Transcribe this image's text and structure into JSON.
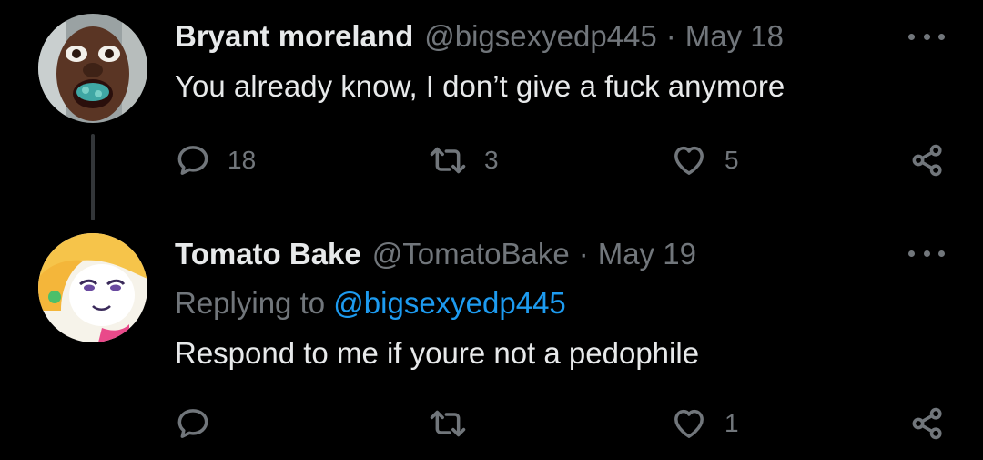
{
  "tweets": [
    {
      "display_name": "Bryant moreland",
      "handle": "@bigsexyedp445",
      "separator": "·",
      "date": "May 18",
      "text": "You already know, I don’t give a fuck anymore",
      "replies": "18",
      "retweets": "3",
      "likes": "5",
      "avatar_icon": "user-avatar-photo"
    },
    {
      "display_name": "Tomato Bake",
      "handle": "@TomatoBake",
      "separator": "·",
      "date": "May 19",
      "reply_prefix": "Replying to",
      "reply_handle": "@bigsexyedp445",
      "text": "Respond to me if youre not a pedophile",
      "replies": "",
      "retweets": "",
      "likes": "1",
      "avatar_icon": "cartoon-avatar"
    }
  ],
  "icons": {
    "reply": "speech-bubble-icon",
    "retweet": "retweet-icon",
    "like": "heart-icon",
    "share": "share-icon",
    "more": "more-dots-icon"
  },
  "colors": {
    "background": "#000000",
    "text": "#e7e9ea",
    "muted": "#71767b",
    "link": "#1d9bf0",
    "thread_line": "#333639"
  }
}
